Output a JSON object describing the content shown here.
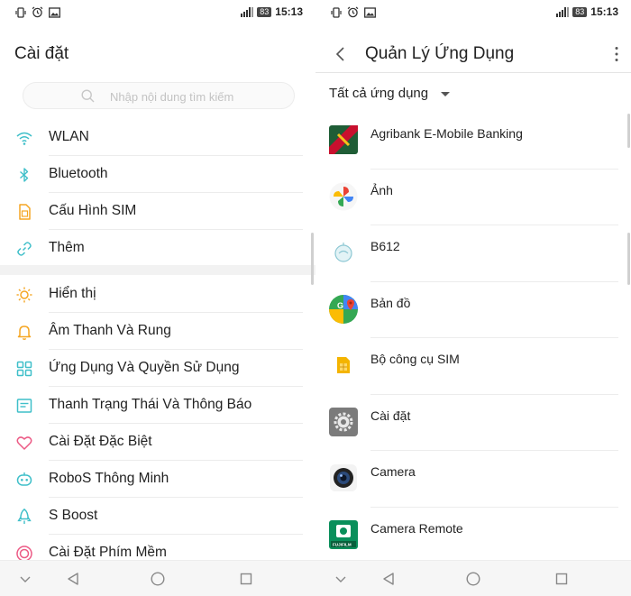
{
  "status": {
    "battery": "83",
    "time": "15:13"
  },
  "settings": {
    "title": "Cài đặt",
    "search_placeholder": "Nhập nội dung tìm kiếm",
    "group1": [
      {
        "label": "WLAN",
        "icon": "wifi-icon"
      },
      {
        "label": "Bluetooth",
        "icon": "bluetooth-icon"
      },
      {
        "label": "Cấu Hình SIM",
        "icon": "sim-icon"
      },
      {
        "label": "Thêm",
        "icon": "link-icon"
      }
    ],
    "group2": [
      {
        "label": "Hiển thị",
        "icon": "sun-icon"
      },
      {
        "label": "Âm Thanh Và Rung",
        "icon": "bell-icon"
      },
      {
        "label": "Ứng Dụng Và Quyền Sử Dụng",
        "icon": "apps-grid-icon"
      },
      {
        "label": "Thanh Trạng Thái Và Thông Báo",
        "icon": "notification-panel-icon"
      },
      {
        "label": "Cài Đặt Đặc Biệt",
        "icon": "heart-icon"
      },
      {
        "label": "RoboS Thông Minh",
        "icon": "robot-icon"
      },
      {
        "label": "S Boost",
        "icon": "rocket-icon"
      },
      {
        "label": "Cài Đặt Phím Mềm",
        "icon": "soft-key-icon"
      }
    ],
    "colors": {
      "accent": "#3fbfc9",
      "orange": "#f5a623",
      "pink": "#ec5a85"
    }
  },
  "apps_screen": {
    "title": "Quản Lý Ứng Dụng",
    "filter": "Tất cả ứng dụng",
    "apps": [
      {
        "label": "Agribank E-Mobile Banking",
        "icon": "agribank-icon"
      },
      {
        "label": "Ảnh",
        "icon": "photos-pinwheel-icon"
      },
      {
        "label": "B612",
        "icon": "b612-icon"
      },
      {
        "label": "Bản đồ",
        "icon": "maps-icon"
      },
      {
        "label": "Bộ công cụ SIM",
        "icon": "sim-toolkit-icon"
      },
      {
        "label": "Cài đặt",
        "icon": "settings-gear-icon"
      },
      {
        "label": "Camera",
        "icon": "camera-icon"
      },
      {
        "label": "Camera Remote",
        "icon": "camera-remote-icon"
      }
    ],
    "camera_remote_badge": "FUJIFILM"
  }
}
